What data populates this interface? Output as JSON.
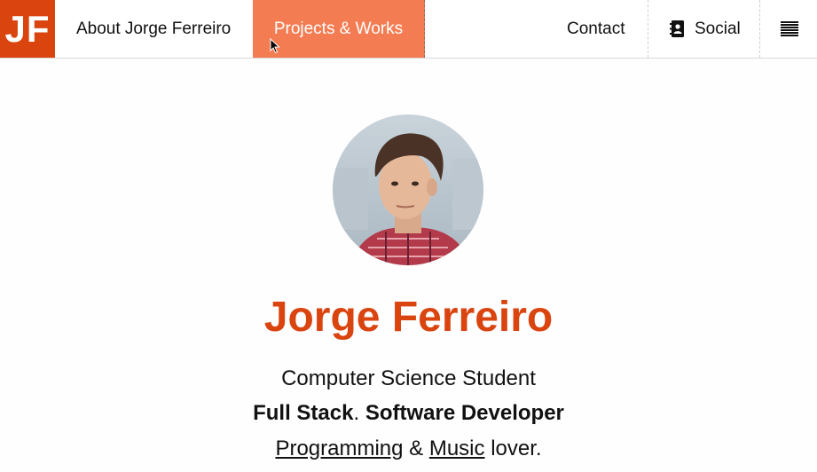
{
  "nav": {
    "logo_text": "JF",
    "about_label": "About Jorge Ferreiro",
    "projects_label": "Projects & Works",
    "contact_label": "Contact",
    "social_label": "Social",
    "social_icon": "contact-book-icon",
    "menu_icon": "hamburger-menu-icon",
    "active_tab": "Projects & Works"
  },
  "colors": {
    "brand": "#d9440f",
    "active_tab": "#f47c52"
  },
  "profile": {
    "name": "Jorge Ferreiro",
    "line1": "Computer Science Student",
    "line2_part1": "Full Stack",
    "line2_sep": ".",
    "line2_part2": "Software Developer",
    "line3_link1": "Programming",
    "line3_amp": "&",
    "line3_link2": "Music",
    "line3_end": "lover."
  }
}
